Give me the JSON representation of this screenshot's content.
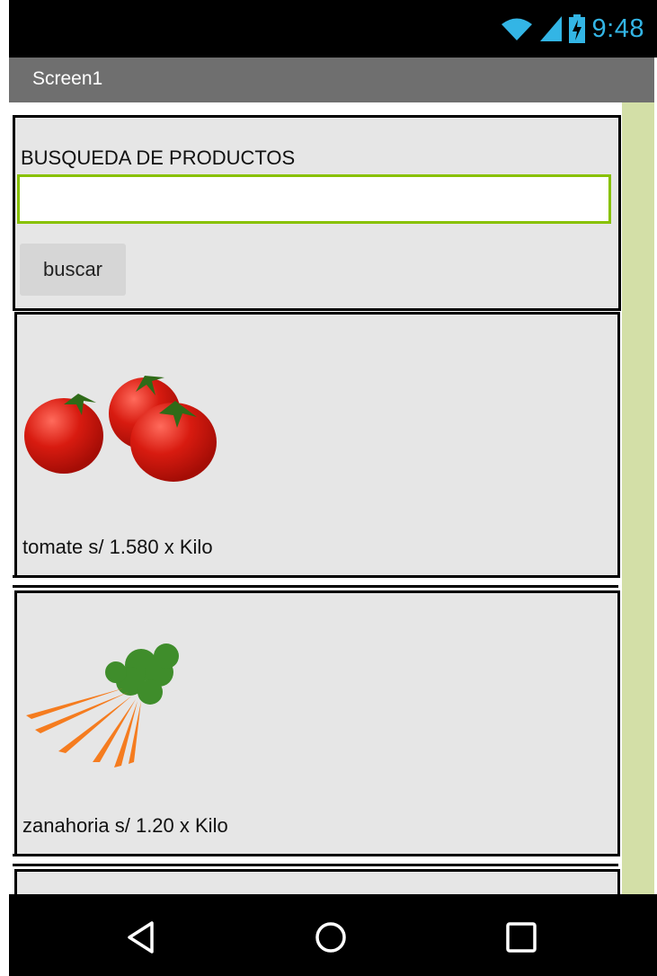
{
  "status_bar": {
    "time": "9:48",
    "icons": [
      "wifi-icon",
      "signal-icon",
      "battery-charging-icon"
    ]
  },
  "app_bar": {
    "title": "Screen1"
  },
  "search": {
    "label": "BUSQUEDA DE PRODUCTOS",
    "input_value": "",
    "input_placeholder": "",
    "button_label": "buscar"
  },
  "products": [
    {
      "image": "tomato-image",
      "label": "tomate s/ 1.580 x Kilo"
    },
    {
      "image": "carrot-image",
      "label": "zanahoria s/ 1.20 x Kilo"
    }
  ],
  "nav_bar": {
    "icons": [
      "back-icon",
      "home-icon",
      "recents-icon"
    ]
  },
  "colors": {
    "accent": "#88c100",
    "status_time": "#33b5e5",
    "app_bar": "#6f6f6f",
    "side_strip": "#d3dfa7",
    "panel": "#e6e6e6"
  }
}
